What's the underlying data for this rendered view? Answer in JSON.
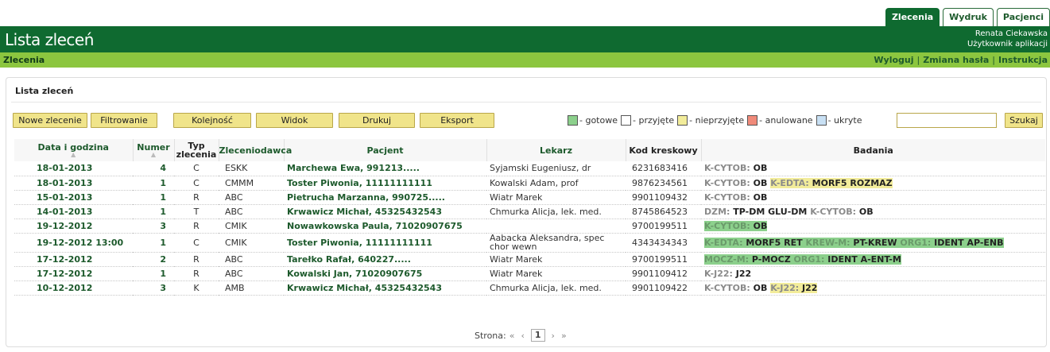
{
  "tabs": [
    "Zlecenia",
    "Wydruk",
    "Pacjenci"
  ],
  "header": {
    "title": "Lista zleceń",
    "user_name": "Renata Ciekawska",
    "user_role": "Użytkownik aplikacji"
  },
  "subbar": {
    "crumb": "Zlecenia",
    "logout": "Wyloguj",
    "change_password": "Zmiana hasła",
    "instructions": "Instrukcja"
  },
  "panel_title": "Lista zleceń",
  "toolbar": {
    "new_order": "Nowe zlecenie",
    "filter": "Filtrowanie",
    "order": "Kolejność",
    "view": "Widok",
    "print": "Drukuj",
    "export": "Eksport",
    "search": "Szukaj",
    "search_value": ""
  },
  "legend": [
    {
      "label": "- gotowe",
      "color": "#8cd08c"
    },
    {
      "label": "- przyjęte",
      "color": "#ffffff"
    },
    {
      "label": "- nieprzyjęte",
      "color": "#f2ec9a"
    },
    {
      "label": "- anulowane",
      "color": "#f08a7a"
    },
    {
      "label": "- ukryte",
      "color": "#c8e0f4"
    }
  ],
  "columns": {
    "date": "Data i godzina",
    "number": "Numer",
    "type": "Typ zlecenia",
    "ordering": "Zleceniodawca",
    "patient": "Pacjent",
    "doctor": "Lekarz",
    "barcode": "Kod kreskowy",
    "tests": "Badania"
  },
  "rows": [
    {
      "date": "18-01-2013",
      "number": "4",
      "type": "C",
      "ordering": "ESKK",
      "patient": "Marchewa Ewa, 991213.....",
      "doctor": "Syjamski Eugeniusz, dr",
      "barcode": "6231683416",
      "tests": [
        {
          "hl": "",
          "parts": [
            [
              "K-CYTOB:",
              "OB"
            ]
          ]
        }
      ]
    },
    {
      "date": "18-01-2013",
      "number": "1",
      "type": "C",
      "ordering": "CMMM",
      "patient": "Toster Piwonia, 11111111111",
      "doctor": "Kowalski Adam, prof",
      "barcode": "9876234561",
      "tests": [
        {
          "hl": "",
          "parts": [
            [
              "K-CYTOB:",
              "OB"
            ]
          ]
        },
        {
          "hl": "y",
          "parts": [
            [
              "K-EDTA:",
              "MORF5 ROZMAZ"
            ]
          ]
        }
      ]
    },
    {
      "date": "15-01-2013",
      "number": "1",
      "type": "R",
      "ordering": "ABC",
      "patient": "Pietrucha Marzanna, 990725.....",
      "doctor": "Wiatr Marek",
      "barcode": "9901109432",
      "tests": [
        {
          "hl": "",
          "parts": [
            [
              "K-CYTOB:",
              "OB"
            ]
          ]
        }
      ]
    },
    {
      "date": "14-01-2013",
      "number": "1",
      "type": "T",
      "ordering": "ABC",
      "patient": "Krwawicz Michał, 45325432543",
      "doctor": "Chmurka Alicja, lek. med.",
      "barcode": "8745864523",
      "tests": [
        {
          "hl": "",
          "parts": [
            [
              "DZM:",
              "TP-DM GLU-DM"
            ],
            [
              "K-CYTOB:",
              "OB"
            ]
          ]
        }
      ]
    },
    {
      "date": "19-12-2012",
      "number": "3",
      "type": "R",
      "ordering": "CMIK",
      "patient": "Nowawkowska Paula, 71020907675",
      "doctor": "",
      "barcode": "9700199511",
      "tests": [
        {
          "hl": "g",
          "parts": [
            [
              "K-CYTOB:",
              "OB"
            ]
          ]
        }
      ]
    },
    {
      "date": "19-12-2012 13:00",
      "number": "1",
      "type": "C",
      "ordering": "CMIK",
      "patient": "Toster Piwonia, 11111111111",
      "doctor": "Aabacka Aleksandra, spec chor wewn",
      "barcode": "4343434343",
      "tests": [
        {
          "hl": "g",
          "parts": [
            [
              "K-EDTA:",
              "MORF5 RET"
            ],
            [
              "KREW-M:",
              "PT-KREW"
            ],
            [
              "ORG1:",
              "IDENT AP-ENB"
            ]
          ]
        }
      ]
    },
    {
      "date": "17-12-2012",
      "number": "2",
      "type": "R",
      "ordering": "ABC",
      "patient": "Tarełko Rafał, 640227.....",
      "doctor": "Wiatr Marek",
      "barcode": "9700199511",
      "tests": [
        {
          "hl": "g",
          "parts": [
            [
              "MOCZ-M:",
              "P-MOCZ"
            ],
            [
              "ORG1:",
              "IDENT A-ENT-M"
            ]
          ]
        }
      ]
    },
    {
      "date": "17-12-2012",
      "number": "1",
      "type": "R",
      "ordering": "ABC",
      "patient": "Kowalski Jan, 71020907675",
      "doctor": "Wiatr Marek",
      "barcode": "9901109412",
      "tests": [
        {
          "hl": "",
          "parts": [
            [
              "K-J22:",
              "J22"
            ]
          ]
        }
      ]
    },
    {
      "date": "10-12-2012",
      "number": "3",
      "type": "K",
      "ordering": "AMB",
      "patient": "Krwawicz Michał, 45325432543",
      "doctor": "Chmurka Alicja, lek. med.",
      "barcode": "9901109422",
      "tests": [
        {
          "hl": "",
          "parts": [
            [
              "K-CYTOB:",
              "OB"
            ]
          ]
        },
        {
          "hl": "y",
          "parts": [
            [
              "K-J22:",
              "J22"
            ]
          ]
        }
      ]
    }
  ],
  "pager": {
    "label": "Strona:",
    "first": "«",
    "prev": "‹",
    "current": "1",
    "next": "›",
    "last": "»"
  }
}
